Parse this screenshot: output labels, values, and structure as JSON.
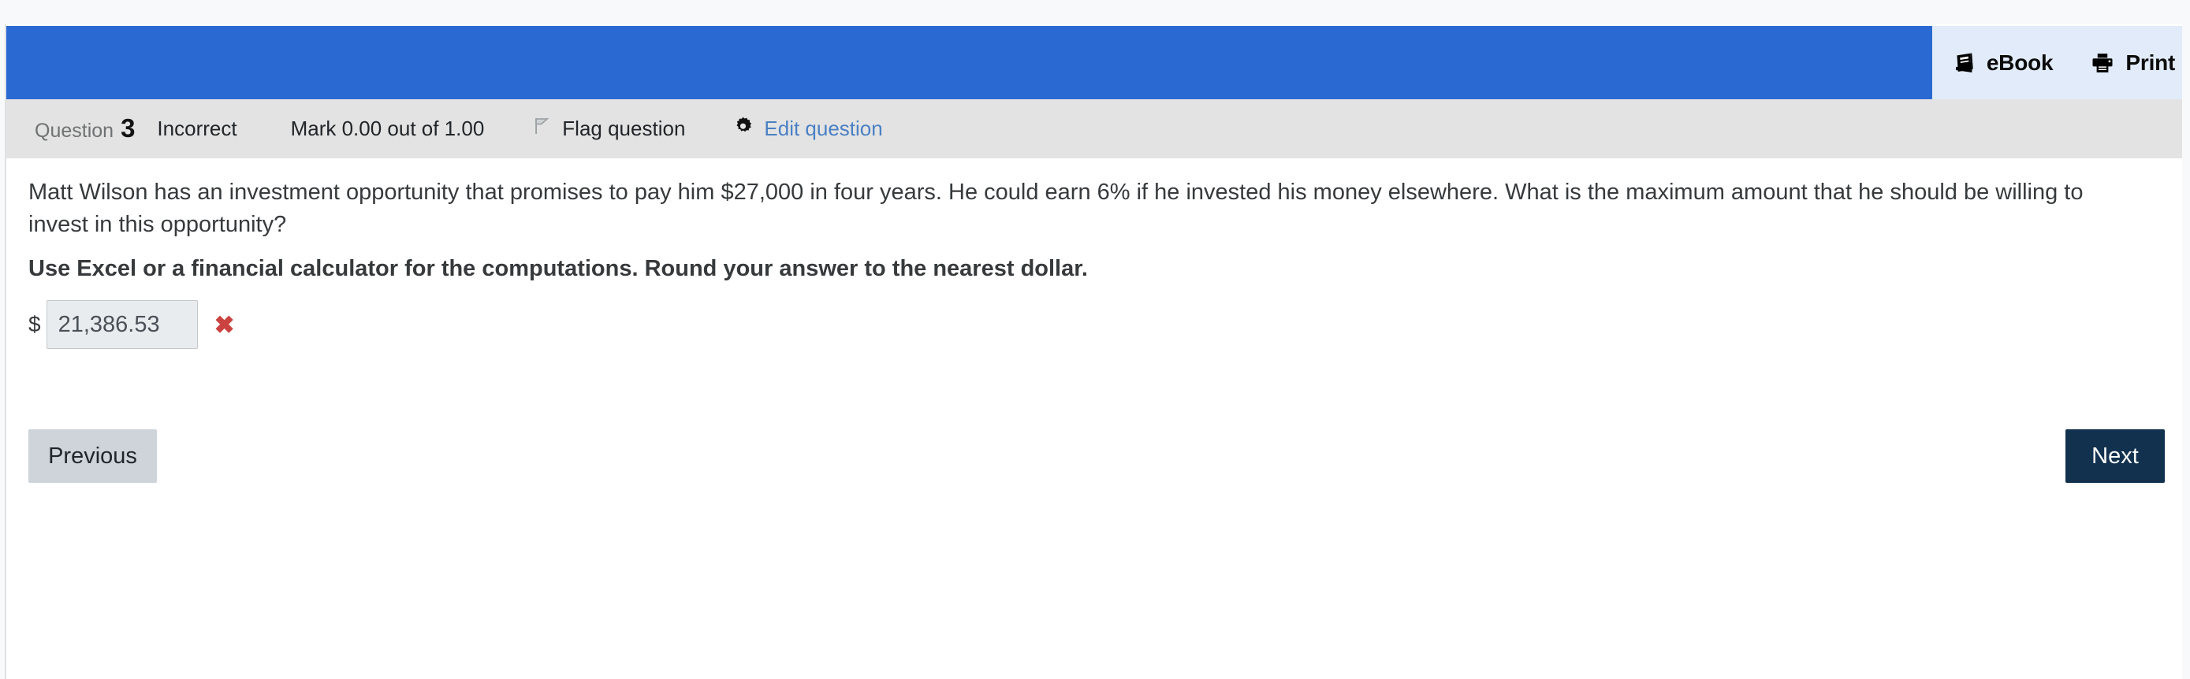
{
  "toolbar": {
    "ebook_label": "eBook",
    "ebook_icon": "book-icon",
    "print_label": "Print",
    "print_icon": "printer-icon",
    "bar_color": "#2a69d1",
    "panel_color": "#e2ebf9"
  },
  "question_info": {
    "question_label": "Question",
    "question_number": "3",
    "state": "Incorrect",
    "mark": "Mark 0.00 out of 1.00",
    "flag_label": "Flag question",
    "flag_icon": "flag-icon",
    "edit_label": "Edit question",
    "edit_icon": "gear-icon",
    "edit_link_color": "#4a80c4"
  },
  "question": {
    "text": "Matt Wilson has an investment opportunity that promises to pay him $27,000 in four years. He could earn 6% if he invested his money elsewhere. What is the maximum amount that he should be willing to invest in this opportunity?",
    "instruction": "Use Excel or a financial calculator for the computations. Round your answer to the nearest dollar."
  },
  "answer": {
    "currency_symbol": "$",
    "value": "21,386.53",
    "placeholder": "",
    "result_icon": "cross-mark-incorrect",
    "result_glyph": "✖",
    "result_color": "#ca4340"
  },
  "navigation": {
    "previous_label": "Previous",
    "next_label": "Next",
    "next_color": "#12314f",
    "previous_color": "#ced4da"
  }
}
